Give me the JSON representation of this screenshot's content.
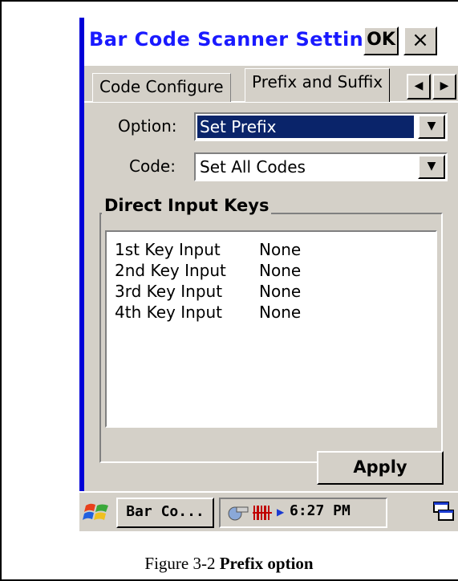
{
  "window": {
    "title": "Bar Code Scanner Settings",
    "ok_label": "OK",
    "close_label": "×"
  },
  "tabs": [
    {
      "label": "Code Configure",
      "active": false
    },
    {
      "label": "Prefix and Suffix",
      "active": true
    }
  ],
  "tab_scroll": {
    "left_icon": "arrow-left-icon",
    "right_icon": "arrow-right-icon"
  },
  "option": {
    "label": "Option:",
    "value": "Set Prefix"
  },
  "code": {
    "label": "Code:",
    "value": "Set All Codes"
  },
  "group": {
    "title": "Direct Input Keys",
    "rows": [
      {
        "key": "1st  Key Input",
        "value": "None"
      },
      {
        "key": "2nd Key Input",
        "value": "None"
      },
      {
        "key": "3rd Key Input",
        "value": "None"
      },
      {
        "key": "4th Key Input",
        "value": "None"
      }
    ]
  },
  "apply_label": "Apply",
  "taskbar": {
    "task_label": "Bar Co...",
    "clock": "6:27 PM",
    "start_icon": "windows-flag-icon",
    "tray_icons": [
      "network-icon",
      "barcode-icon",
      "arrow-right-icon"
    ],
    "sip_icon": "keyboard-icon"
  },
  "caption": {
    "prefix": "Figure 3-2 ",
    "bold": "Prefix option"
  },
  "colors": {
    "title_text": "#1a1aff",
    "panel": "#d4d0c8",
    "selection": "#0a246a",
    "edge": "#0000d8"
  }
}
